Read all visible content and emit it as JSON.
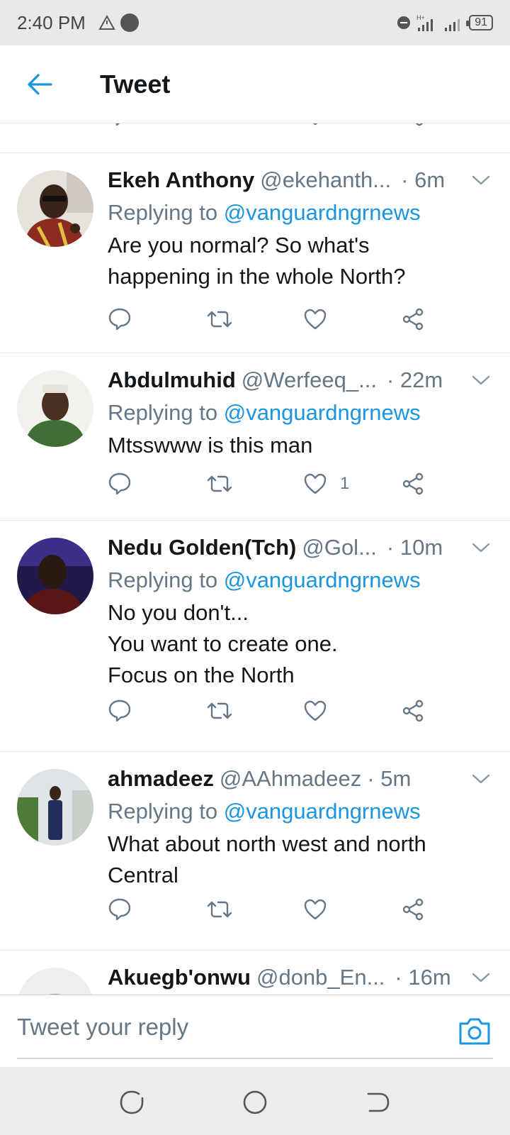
{
  "status_bar": {
    "time": "2:40 PM",
    "battery": "91",
    "icons": [
      "warning-triangle-icon",
      "record-dot-icon",
      "do-not-disturb-icon",
      "signal-h-plus-icon",
      "signal-icon"
    ]
  },
  "header": {
    "back_icon": "arrow-left-icon",
    "title": "Tweet"
  },
  "tweets": [
    {
      "name": "Ekeh Anthony",
      "handle": "@ekehanth...",
      "time": "· 6m",
      "replying_prefix": "Replying to",
      "replying_to": "@vanguardngrnews",
      "lines": [
        "Are you normal? So what's",
        "happening in the whole North?"
      ],
      "like_count": ""
    },
    {
      "name": "Abdulmuhid",
      "handle": "@Werfeeq_...",
      "time": "· 22m",
      "replying_prefix": "Replying to",
      "replying_to": "@vanguardngrnews",
      "lines": [
        "Mtsswww is this man"
      ],
      "like_count": "1"
    },
    {
      "name": "Nedu Golden(Tch)",
      "handle": "@Gol...",
      "time": "· 10m",
      "replying_prefix": "Replying to",
      "replying_to": "@vanguardngrnews",
      "lines": [
        "No you don't...",
        "You want to create one.",
        "Focus on the North"
      ],
      "like_count": ""
    },
    {
      "name": "ahmadeez",
      "handle": "@AAhmadeez",
      "time": "· 5m",
      "replying_prefix": "Replying to",
      "replying_to": "@vanguardngrnews",
      "lines": [
        "What about north west and north",
        "Central"
      ],
      "like_count": ""
    },
    {
      "name": "Akuegb'onwu",
      "handle": "@donb_En...",
      "time": "· 16m"
    }
  ],
  "reply_bar": {
    "placeholder": "Tweet your reply",
    "camera_icon": "camera-icon"
  },
  "nav_bar": {
    "icons": [
      "recent-apps-icon",
      "home-circle-icon",
      "back-nav-icon"
    ]
  },
  "colors": {
    "accent": "#1b95e0",
    "secondary_text": "#657786",
    "primary_text": "#14171a",
    "divider": "#e1e8ed",
    "status_bar_bg": "#e9e9e9",
    "nav_bar_bg": "#ececec"
  }
}
